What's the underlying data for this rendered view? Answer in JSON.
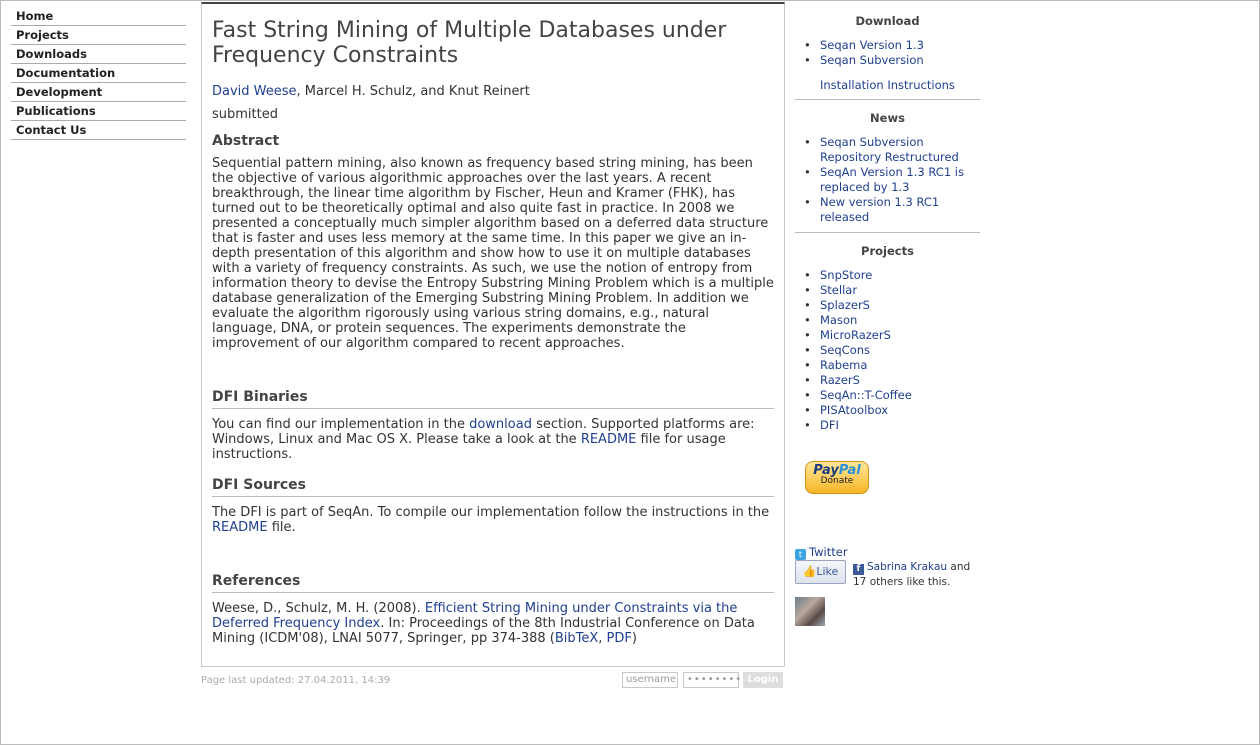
{
  "nav": {
    "items": [
      "Home",
      "Projects",
      "Downloads",
      "Documentation",
      "Development",
      "Publications",
      "Contact Us"
    ]
  },
  "paper": {
    "title": "Fast String Mining of Multiple Databases under Frequency Constraints",
    "author_link": "David Weese",
    "authors_rest": ", Marcel H. Schulz, and Knut Reinert",
    "status": "submitted",
    "abstract_heading": "Abstract",
    "abstract": "Sequential pattern mining, also known as frequency based string mining, has been the objective of various algorithmic approaches over the last years. A recent breakthrough, the linear time algorithm by Fischer, Heun and Kramer (FHK), has turned out to be theoretically optimal and also quite fast in practice. In 2008 we presented a conceptually much simpler algorithm based on a deferred data structure that is faster and uses less memory at the same time. In this paper we give an in-depth presentation of this algorithm and show how to use it on multiple databases with a variety of frequency constraints. As such, we use the notion of entropy from information theory to devise the Entropy Substring Mining Problem which is a multiple database generalization of the Emerging Substring Mining Problem. In addition we evaluate the algorithm rigorously using various string domains, e.g., natural language, DNA, or protein sequences. The experiments demonstrate the improvement of our algorithm compared to recent approaches.",
    "binaries_heading": "DFI Binaries",
    "binaries_text_1": "You can find our implementation in the ",
    "binaries_link_download": "download",
    "binaries_text_2": " section. Supported platforms are: Windows, Linux and Mac OS X. Please take a look at the ",
    "binaries_link_readme": "README",
    "binaries_text_3": " file for usage instructions.",
    "sources_heading": "DFI Sources",
    "sources_text_1": "The DFI is part of SeqAn. To compile our implementation follow the instructions in the ",
    "sources_link_readme": "README",
    "sources_text_2": " file.",
    "references_heading": "References",
    "ref_text_1": "Weese, D., Schulz, M. H. (2008). ",
    "ref_link_title": "Efficient String Mining under Constraints via the Deferred Frequency Index",
    "ref_text_2": ". In: Proceedings of the 8th Industrial Conference on Data Mining (ICDM'08), LNAI 5077, Springer, pp 374-388 (",
    "ref_link_bibtex": "BibTeX",
    "ref_text_3": ", ",
    "ref_link_pdf": "PDF",
    "ref_text_4": ")"
  },
  "footer": {
    "updated": "Page last updated: 27.04.2011, 14:39",
    "username_placeholder": "username",
    "password_placeholder": "••••••••",
    "login_label": "Login"
  },
  "sidebar": {
    "download": {
      "title": "Download",
      "items": [
        "Seqan Version 1.3",
        "Seqan Subversion"
      ],
      "extra": "Installation Instructions"
    },
    "news": {
      "title": "News",
      "items": [
        "Seqan Subversion Repository Restructured",
        "SeqAn Version 1.3 RC1 is replaced by 1.3",
        "New version 1.3 RC1 released"
      ]
    },
    "projects": {
      "title": "Projects",
      "items": [
        "SnpStore",
        "Stellar",
        "SplazerS",
        "Mason",
        "MicroRazerS",
        "SeqCons",
        "Rabema",
        "RazerS",
        "SeqAn::T-Coffee",
        "PISAtoolbox",
        "DFI"
      ]
    },
    "paypal": {
      "brand_a": "Pay",
      "brand_b": "Pal",
      "label": "Donate"
    },
    "twitter": {
      "label": "Twitter",
      "icon": "twitter-icon"
    },
    "facebook": {
      "like_label": "Like",
      "liker_name": "Sabrina Krakau",
      "liker_rest": " and 17 others like this.",
      "icon": "facebook-icon"
    }
  }
}
